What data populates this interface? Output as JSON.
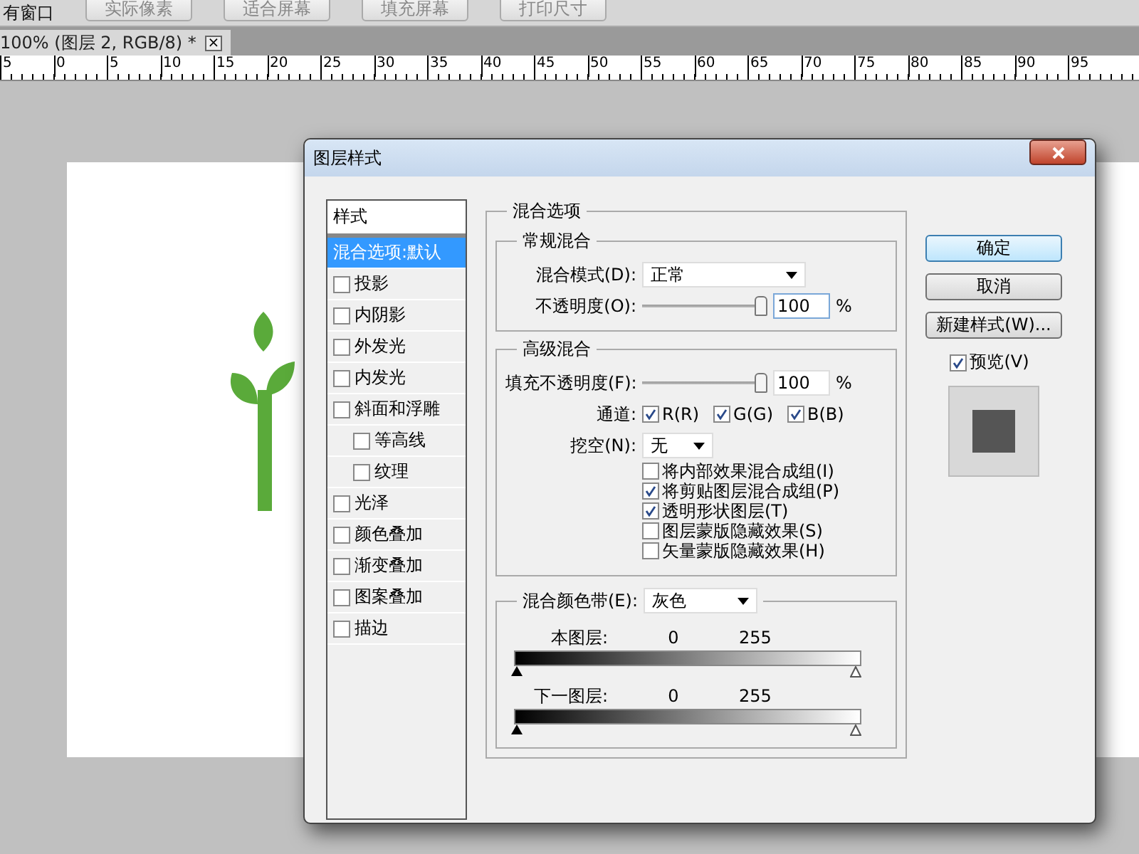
{
  "toolbar": {
    "window_label": "有窗口",
    "buttons": [
      "实际像素",
      "适合屏幕",
      "填充屏幕",
      "打印尺寸"
    ]
  },
  "document_tab": {
    "title": "100% (图层 2, RGB/8) *",
    "close": "×"
  },
  "ruler": {
    "ticks": [
      "5",
      "0",
      "5",
      "10",
      "15",
      "20",
      "25",
      "30",
      "35",
      "40",
      "45",
      "50",
      "55",
      "60",
      "65",
      "70",
      "75",
      "80",
      "85",
      "90",
      "95"
    ]
  },
  "dialog": {
    "title": "图层样式",
    "styles_header": "样式",
    "styles": [
      {
        "label": "混合选项:默认",
        "kind": "plain",
        "selected": true
      },
      {
        "label": "投影",
        "kind": "check",
        "checked": false,
        "selected": false
      },
      {
        "label": "内阴影",
        "kind": "check",
        "checked": false,
        "selected": false
      },
      {
        "label": "外发光",
        "kind": "check",
        "checked": false,
        "selected": false
      },
      {
        "label": "内发光",
        "kind": "check",
        "checked": false,
        "selected": false
      },
      {
        "label": "斜面和浮雕",
        "kind": "check",
        "checked": false,
        "selected": false,
        "children": [
          {
            "label": "等高线",
            "kind": "check",
            "checked": false,
            "selected": false
          },
          {
            "label": "纹理",
            "kind": "check",
            "checked": false,
            "selected": false
          }
        ]
      },
      {
        "label": "光泽",
        "kind": "check",
        "checked": false,
        "selected": false
      },
      {
        "label": "颜色叠加",
        "kind": "check",
        "checked": false,
        "selected": false
      },
      {
        "label": "渐变叠加",
        "kind": "check",
        "checked": false,
        "selected": false
      },
      {
        "label": "图案叠加",
        "kind": "check",
        "checked": false,
        "selected": false
      },
      {
        "label": "描边",
        "kind": "check",
        "checked": false,
        "selected": false
      }
    ],
    "blend_options": {
      "title": "混合选项",
      "general": {
        "title": "常规混合",
        "mode_label": "混合模式(D):",
        "mode": "正常",
        "opacity_label": "不透明度(O):",
        "opacity": {
          "level": 1,
          "value": "100",
          "unit": "%"
        }
      },
      "advanced": {
        "title": "高级混合",
        "fill_label": "填充不透明度(F):",
        "fill": {
          "level": 1,
          "value": "100",
          "unit": "%"
        },
        "channels_label": "通道:",
        "channels": [
          {
            "label": "R(R)",
            "checked": true
          },
          {
            "label": "G(G)",
            "checked": true
          },
          {
            "label": "B(B)",
            "checked": true
          }
        ],
        "knockout_label": "挖空(N):",
        "knockout": "无",
        "options": [
          {
            "label": "将内部效果混合成组(I)",
            "checked": false
          },
          {
            "label": "将剪贴图层混合成组(P)",
            "checked": true
          },
          {
            "label": "透明形状图层(T)",
            "checked": true
          },
          {
            "label": "图层蒙版隐藏效果(S)",
            "checked": false
          },
          {
            "label": "矢量蒙版隐藏效果(H)",
            "checked": false
          }
        ]
      },
      "blend_if": {
        "label": "混合颜色带(E):",
        "value": "灰色",
        "bands": [
          {
            "label": "本图层:",
            "low": "0",
            "high": "255"
          },
          {
            "label": "下一图层:",
            "low": "0",
            "high": "255"
          }
        ]
      }
    },
    "buttons": [
      "确定",
      "取消",
      "新建样式(W)..."
    ],
    "preview": {
      "label": "预览(V)",
      "checked": true
    }
  }
}
